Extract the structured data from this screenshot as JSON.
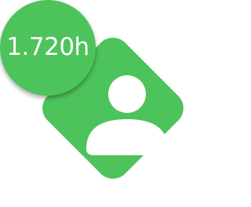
{
  "badge": {
    "label": "1.720h",
    "color": "#4dc35b"
  },
  "tile": {
    "color": "#4dc35b",
    "icon": "user-icon"
  }
}
